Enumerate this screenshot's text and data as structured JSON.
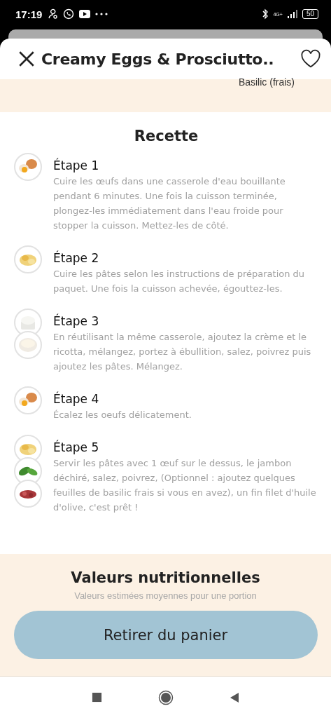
{
  "status_bar": {
    "time": "17:19",
    "network": "4G+",
    "battery": "50"
  },
  "header": {
    "title": "Creamy Eggs & Prosciutto..",
    "favorite": false
  },
  "ingredients": [
    {
      "name": "Basilic (frais)"
    }
  ],
  "recipe": {
    "title": "Recette",
    "steps": [
      {
        "title": "Étape 1",
        "text": "Cuire les œufs dans une casserole d'eau bouillante pendant 6 minutes. Une fois la cuisson terminée, plongez-les immédiatement dans l'eau froide pour stopper la cuisson. Mettez-les de côté."
      },
      {
        "title": "Étape 2",
        "text": "Cuire les pâtes selon les instructions de préparation du paquet. Une fois la cuisson achevée, égouttez-les."
      },
      {
        "title": "Étape 3",
        "text": "En réutilisant la même casserole, ajoutez la crème et le ricotta, mélangez, portez à ébullition, salez, poivrez puis ajoutez les pâtes. Mélangez."
      },
      {
        "title": "Étape 4",
        "text": "Écalez les oeufs délicatement."
      },
      {
        "title": "Étape 5",
        "text": "Servir les pâtes avec 1 œuf sur le dessus, le jambon déchiré, salez, poivrez, (Optionnel : ajoutez quelques feuilles de basilic frais si vous en avez), un fin filet d'huile d'olive, c'est prêt !"
      }
    ]
  },
  "nutrition": {
    "title": "Valeurs nutritionnelles",
    "subtitle": "Valeurs estimées moyennes pour une portion"
  },
  "cart_button": "Retirer du panier"
}
